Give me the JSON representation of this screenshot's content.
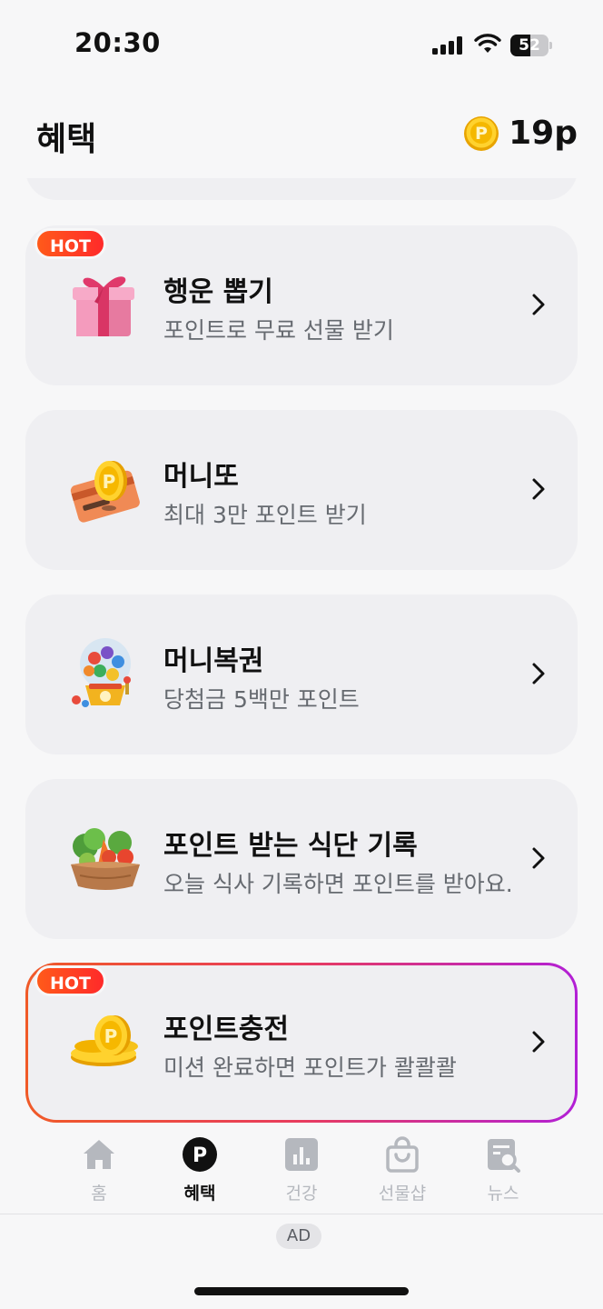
{
  "status_bar": {
    "time": "20:30",
    "battery": "52"
  },
  "header": {
    "title": "혜택",
    "points": "19p"
  },
  "cards": [
    {
      "title": "행운 뽑기",
      "subtitle": "포인트로 무료 선물 받기",
      "badge": "HOT",
      "icon": "gift-box-icon"
    },
    {
      "title": "머니또",
      "subtitle": "최대 3만 포인트 받기",
      "icon": "coin-card-icon"
    },
    {
      "title": "머니복권",
      "subtitle": "당첨금 5백만 포인트",
      "icon": "lottery-machine-icon"
    },
    {
      "title": "포인트 받는 식단 기록",
      "subtitle": "오늘 식사 기록하면 포인트를 받아요.",
      "icon": "vegetable-basket-icon"
    },
    {
      "title": "포인트충전",
      "subtitle": "미션 완료하면 포인트가 콸콸콸",
      "badge": "HOT",
      "icon": "coin-stack-icon"
    }
  ],
  "tabs": [
    {
      "label": "홈",
      "icon": "home-icon"
    },
    {
      "label": "혜택",
      "icon": "point-icon",
      "active": true
    },
    {
      "label": "건강",
      "icon": "chart-icon"
    },
    {
      "label": "선물샵",
      "icon": "shopping-bag-icon"
    },
    {
      "label": "뉴스",
      "icon": "news-search-icon"
    }
  ],
  "ad_label": "AD",
  "colors": {
    "accent_gold": "#f7c21b",
    "hot_red": "#ff3a22",
    "highlight_gradient_start": "#f05a28",
    "highlight_gradient_end": "#b21fd6"
  }
}
